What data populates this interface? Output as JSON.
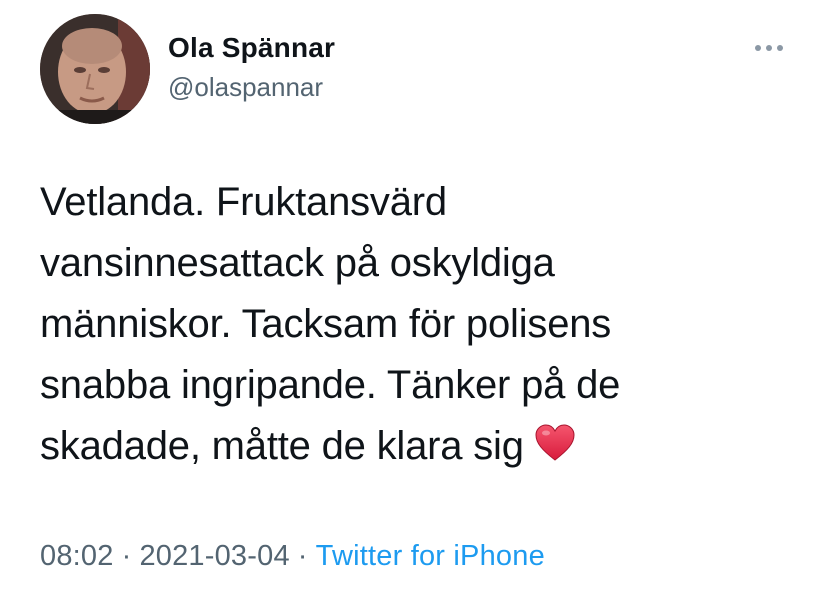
{
  "user": {
    "display_name": "Ola Spännar",
    "handle": "@olaspannar"
  },
  "tweet": {
    "lines": [
      "Vetlanda. Fruktansvärd",
      "vansinnesattack på oskyldiga",
      "människor. Tacksam för polisens",
      "snabba ingripande. Tänker på de",
      "skadade, måtte de klara sig"
    ],
    "emoji": "heart-icon"
  },
  "meta": {
    "time": "08:02",
    "separator": "·",
    "date": "2021-03-04",
    "source": "Twitter for iPhone"
  },
  "icons": {
    "more": "more-options-icon",
    "heart": "heart-icon"
  },
  "colors": {
    "text": "#0f1419",
    "secondary": "#536471",
    "link": "#1d9bf0",
    "heart": "#e0245e"
  }
}
